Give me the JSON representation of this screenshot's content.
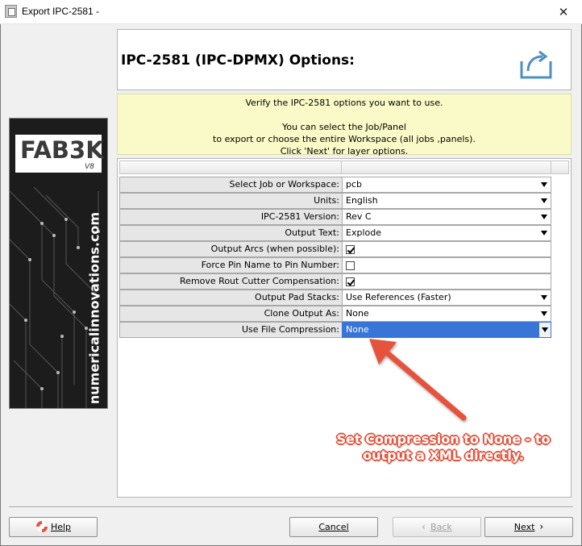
{
  "window": {
    "title": "Export IPC-2581 -",
    "close_glyph": "✕"
  },
  "sidebar": {
    "logo": "FAB3K",
    "logo_version": "V8",
    "website": "numericalinnovations.com"
  },
  "header": {
    "title": "IPC-2581 (IPC-DPMX) Options:",
    "icon": "export-icon"
  },
  "info": {
    "lines": [
      "Verify the IPC-2581 options you want to use.",
      "",
      "You can select the Job/Panel",
      "to export or choose the entire Workspace (all jobs ,panels).",
      "Click 'Next' for layer options."
    ]
  },
  "properties": [
    {
      "label": "Select Job or Workspace:",
      "type": "dropdown",
      "value": "pcb"
    },
    {
      "label": "Units:",
      "type": "dropdown",
      "value": "English"
    },
    {
      "label": "IPC-2581 Version:",
      "type": "dropdown",
      "value": "Rev C"
    },
    {
      "label": "Output Text:",
      "type": "dropdown",
      "value": "Explode"
    },
    {
      "label": "Output Arcs (when possible):",
      "type": "checkbox",
      "checked": true
    },
    {
      "label": "Force Pin Name to Pin Number:",
      "type": "checkbox",
      "checked": false
    },
    {
      "label": "Remove Rout Cutter Compensation:",
      "type": "checkbox",
      "checked": true
    },
    {
      "label": "Output Pad Stacks:",
      "type": "dropdown",
      "value": "Use References (Faster)"
    },
    {
      "label": "Clone Output As:",
      "type": "dropdown",
      "value": "None"
    },
    {
      "label": "Use File Compression:",
      "type": "dropdown",
      "value": "None",
      "selected": true
    }
  ],
  "annotation": {
    "line1": "Set Compression to None - to",
    "line2": "output a XML directly.",
    "color": "#e5533d"
  },
  "buttons": {
    "help": "Help",
    "cancel": "Cancel",
    "back": "Back",
    "next": "Next"
  }
}
